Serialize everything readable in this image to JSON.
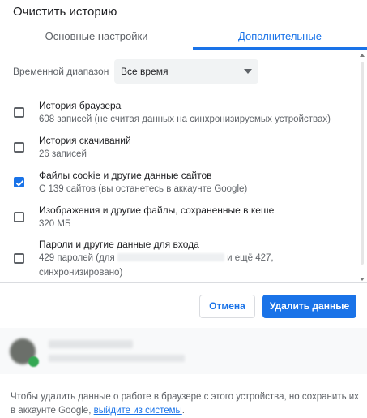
{
  "dialog": {
    "title": "Очистить историю"
  },
  "tabs": [
    {
      "label": "Основные настройки",
      "active": false
    },
    {
      "label": "Дополнительные",
      "active": true
    }
  ],
  "time_range": {
    "label": "Временной диапазон",
    "value": "Все время"
  },
  "options": [
    {
      "title": "История браузера",
      "subtitle": "608 записей (не считая данных на синхронизируемых устройствах)",
      "checked": false
    },
    {
      "title": "История скачиваний",
      "subtitle": "26 записей",
      "checked": false
    },
    {
      "title": "Файлы cookie и другие данные сайтов",
      "subtitle": "С 139 сайтов (вы останетесь в аккаунте Google)",
      "checked": true
    },
    {
      "title": "Изображения и другие файлы, сохраненные в кеше",
      "subtitle": "320 МБ",
      "checked": false
    },
    {
      "title": "Пароли и другие данные для входа",
      "subtitle_prefix": "429 паролей (для",
      "subtitle_suffix": "и ещё 427,",
      "subtitle_line2": "синхронизировано)",
      "checked": false
    }
  ],
  "buttons": {
    "cancel": "Отмена",
    "delete": "Удалить данные"
  },
  "footer": {
    "note_text": "Чтобы удалить данные о работе в браузере с этого устройства, но сохранить их в аккаунте Google,",
    "signout_link": "выйдите из системы",
    "note_end": "."
  },
  "colors": {
    "accent": "#1a73e8",
    "text": "#202124",
    "secondary": "#5f6368",
    "divider": "#dadce0",
    "sync_badge": "#34a853"
  }
}
